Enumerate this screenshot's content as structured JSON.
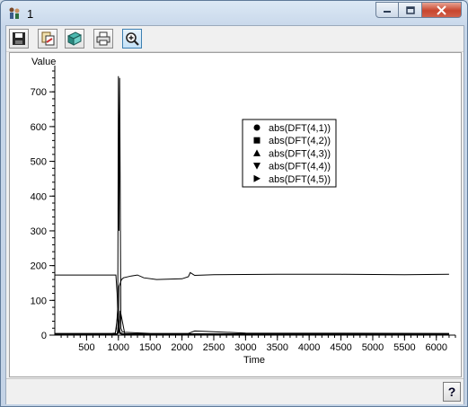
{
  "window": {
    "title": "1",
    "help_label": "?"
  },
  "toolbar": {
    "buttons": [
      {
        "name": "save-icon"
      },
      {
        "name": "copy-icon"
      },
      {
        "name": "export-icon"
      },
      {
        "name": "print-icon"
      },
      {
        "name": "zoom-icon"
      }
    ]
  },
  "chart_data": {
    "type": "line",
    "ylabel": "Value",
    "xlabel": "Time",
    "xlim": [
      0,
      6300
    ],
    "ylim": [
      0,
      760
    ],
    "x_ticks": [
      500,
      1000,
      1500,
      2000,
      2500,
      3000,
      3500,
      4000,
      4500,
      5000,
      5500,
      6000
    ],
    "y_ticks": [
      0,
      100,
      200,
      300,
      400,
      500,
      600,
      700
    ],
    "legend_position": "upper-center",
    "series": [
      {
        "name": "abs(DFT(4,1))",
        "marker": "circle",
        "x": [
          0,
          900,
          950,
          970,
          990,
          1000,
          1010,
          1020,
          1040,
          1060,
          1100,
          1500,
          2100,
          2200,
          3000,
          6200
        ],
        "y": [
          5,
          5,
          6,
          20,
          80,
          745,
          300,
          740,
          20,
          10,
          8,
          5,
          5,
          12,
          6,
          5
        ]
      },
      {
        "name": "abs(DFT(4,2))",
        "marker": "square",
        "x": [
          0,
          900,
          960,
          980,
          1000,
          1010,
          1030,
          1050,
          1080,
          1200,
          1300,
          1400,
          1600,
          2000,
          2100,
          2130,
          2200,
          2500,
          3500,
          4500,
          5500,
          6200
        ],
        "y": [
          173,
          173,
          173,
          120,
          5,
          140,
          150,
          160,
          165,
          170,
          173,
          165,
          160,
          162,
          168,
          180,
          172,
          174,
          175,
          175,
          174,
          175
        ]
      },
      {
        "name": "abs(DFT(4,3))",
        "marker": "triangle-up",
        "x": [
          0,
          950,
          990,
          1010,
          1030,
          1100,
          6200
        ],
        "y": [
          3,
          3,
          60,
          10,
          70,
          4,
          3
        ]
      },
      {
        "name": "abs(DFT(4,4))",
        "marker": "triangle-down",
        "x": [
          0,
          980,
          1000,
          1020,
          1060,
          6200
        ],
        "y": [
          2,
          2,
          30,
          5,
          2,
          2
        ]
      },
      {
        "name": "abs(DFT(4,5))",
        "marker": "triangle-right",
        "x": [
          0,
          990,
          1005,
          1025,
          1070,
          6200
        ],
        "y": [
          4,
          4,
          45,
          8,
          4,
          4
        ]
      }
    ]
  }
}
